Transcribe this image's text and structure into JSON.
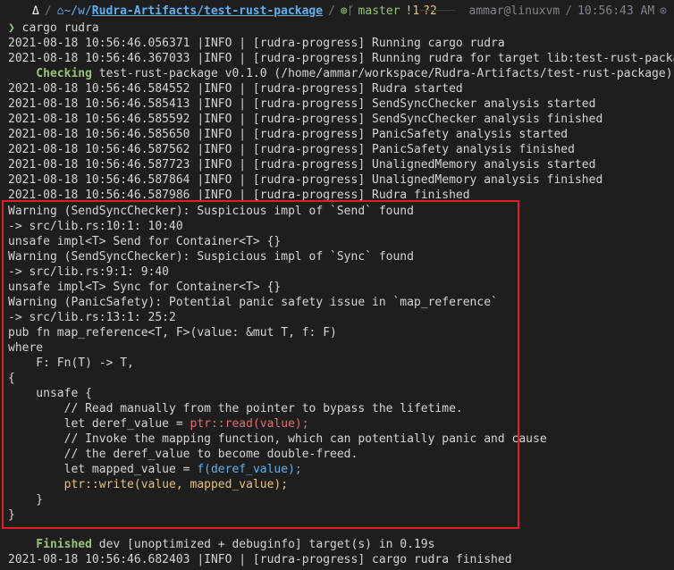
{
  "prompt": {
    "os_icon": "Δ",
    "home_icon": "⌂",
    "path_prefix": "~/w/",
    "path_rest": "Rudra-Artifacts/test-rust-package",
    "branch_icon": "⊕ᚴ",
    "branch": "master",
    "dirty_mod": "!1",
    "dirty_untracked": "?2",
    "user_host": "ammar@linuxvm",
    "time": "10:56:43 AM",
    "clock_icon": "⊙"
  },
  "command": {
    "arrow": "❯",
    "text": " cargo rudra"
  },
  "log_pre": [
    "2021-08-18 10:56:46.056371 |INFO | [rudra-progress] Running cargo rudra",
    "2021-08-18 10:56:46.367033 |INFO | [rudra-progress] Running rudra for target lib:test-rust-package"
  ],
  "checking": {
    "label": "    Checking",
    "rest": " test-rust-package v0.1.0 (/home/ammar/workspace/Rudra-Artifacts/test-rust-package)"
  },
  "log_post": [
    "2021-08-18 10:56:46.584552 |INFO | [rudra-progress] Rudra started",
    "2021-08-18 10:56:46.585413 |INFO | [rudra-progress] SendSyncChecker analysis started",
    "2021-08-18 10:56:46.585592 |INFO | [rudra-progress] SendSyncChecker analysis finished",
    "2021-08-18 10:56:46.585650 |INFO | [rudra-progress] PanicSafety analysis started",
    "2021-08-18 10:56:46.587562 |INFO | [rudra-progress] PanicSafety analysis finished",
    "2021-08-18 10:56:46.587723 |INFO | [rudra-progress] UnalignedMemory analysis started",
    "2021-08-18 10:56:46.587864 |INFO | [rudra-progress] UnalignedMemory analysis finished",
    "2021-08-18 10:56:46.587986 |INFO | [rudra-progress] Rudra finished"
  ],
  "warnings": [
    "Warning (SendSyncChecker): Suspicious impl of `Send` found",
    "-> src/lib.rs:10:1: 10:40",
    "unsafe impl<T> Send for Container<T> {}",
    "Warning (SendSyncChecker): Suspicious impl of `Sync` found",
    "-> src/lib.rs:9:1: 9:40",
    "unsafe impl<T> Sync for Container<T> {}",
    "Warning (PanicSafety): Potential panic safety issue in `map_reference`",
    "-> src/lib.rs:13:1: 25:2",
    "pub fn map_reference<T, F>(value: &mut T, f: F)",
    "where",
    "    F: Fn(T) -> T,",
    "{",
    "    unsafe {",
    "        // Read manually from the pointer to bypass the lifetime."
  ],
  "deref_line": {
    "pre": "        let deref_value = ",
    "call": "ptr::read(value);"
  },
  "comments": [
    "        // Invoke the mapping function, which can potentially panic and cause",
    "        // the deref_value to become double-freed."
  ],
  "mapped_line": {
    "pre": "        let mapped_value = ",
    "call": "f(deref_value);"
  },
  "write_line": "        ptr::write(value, mapped_value);",
  "closing": [
    "    }",
    "}"
  ],
  "finished": {
    "label": "    Finished",
    "rest": " dev [unoptimized + debuginfo] target(s) in 0.19s"
  },
  "log_final": "2021-08-18 10:56:46.682403 |INFO | [rudra-progress] cargo rudra finished"
}
